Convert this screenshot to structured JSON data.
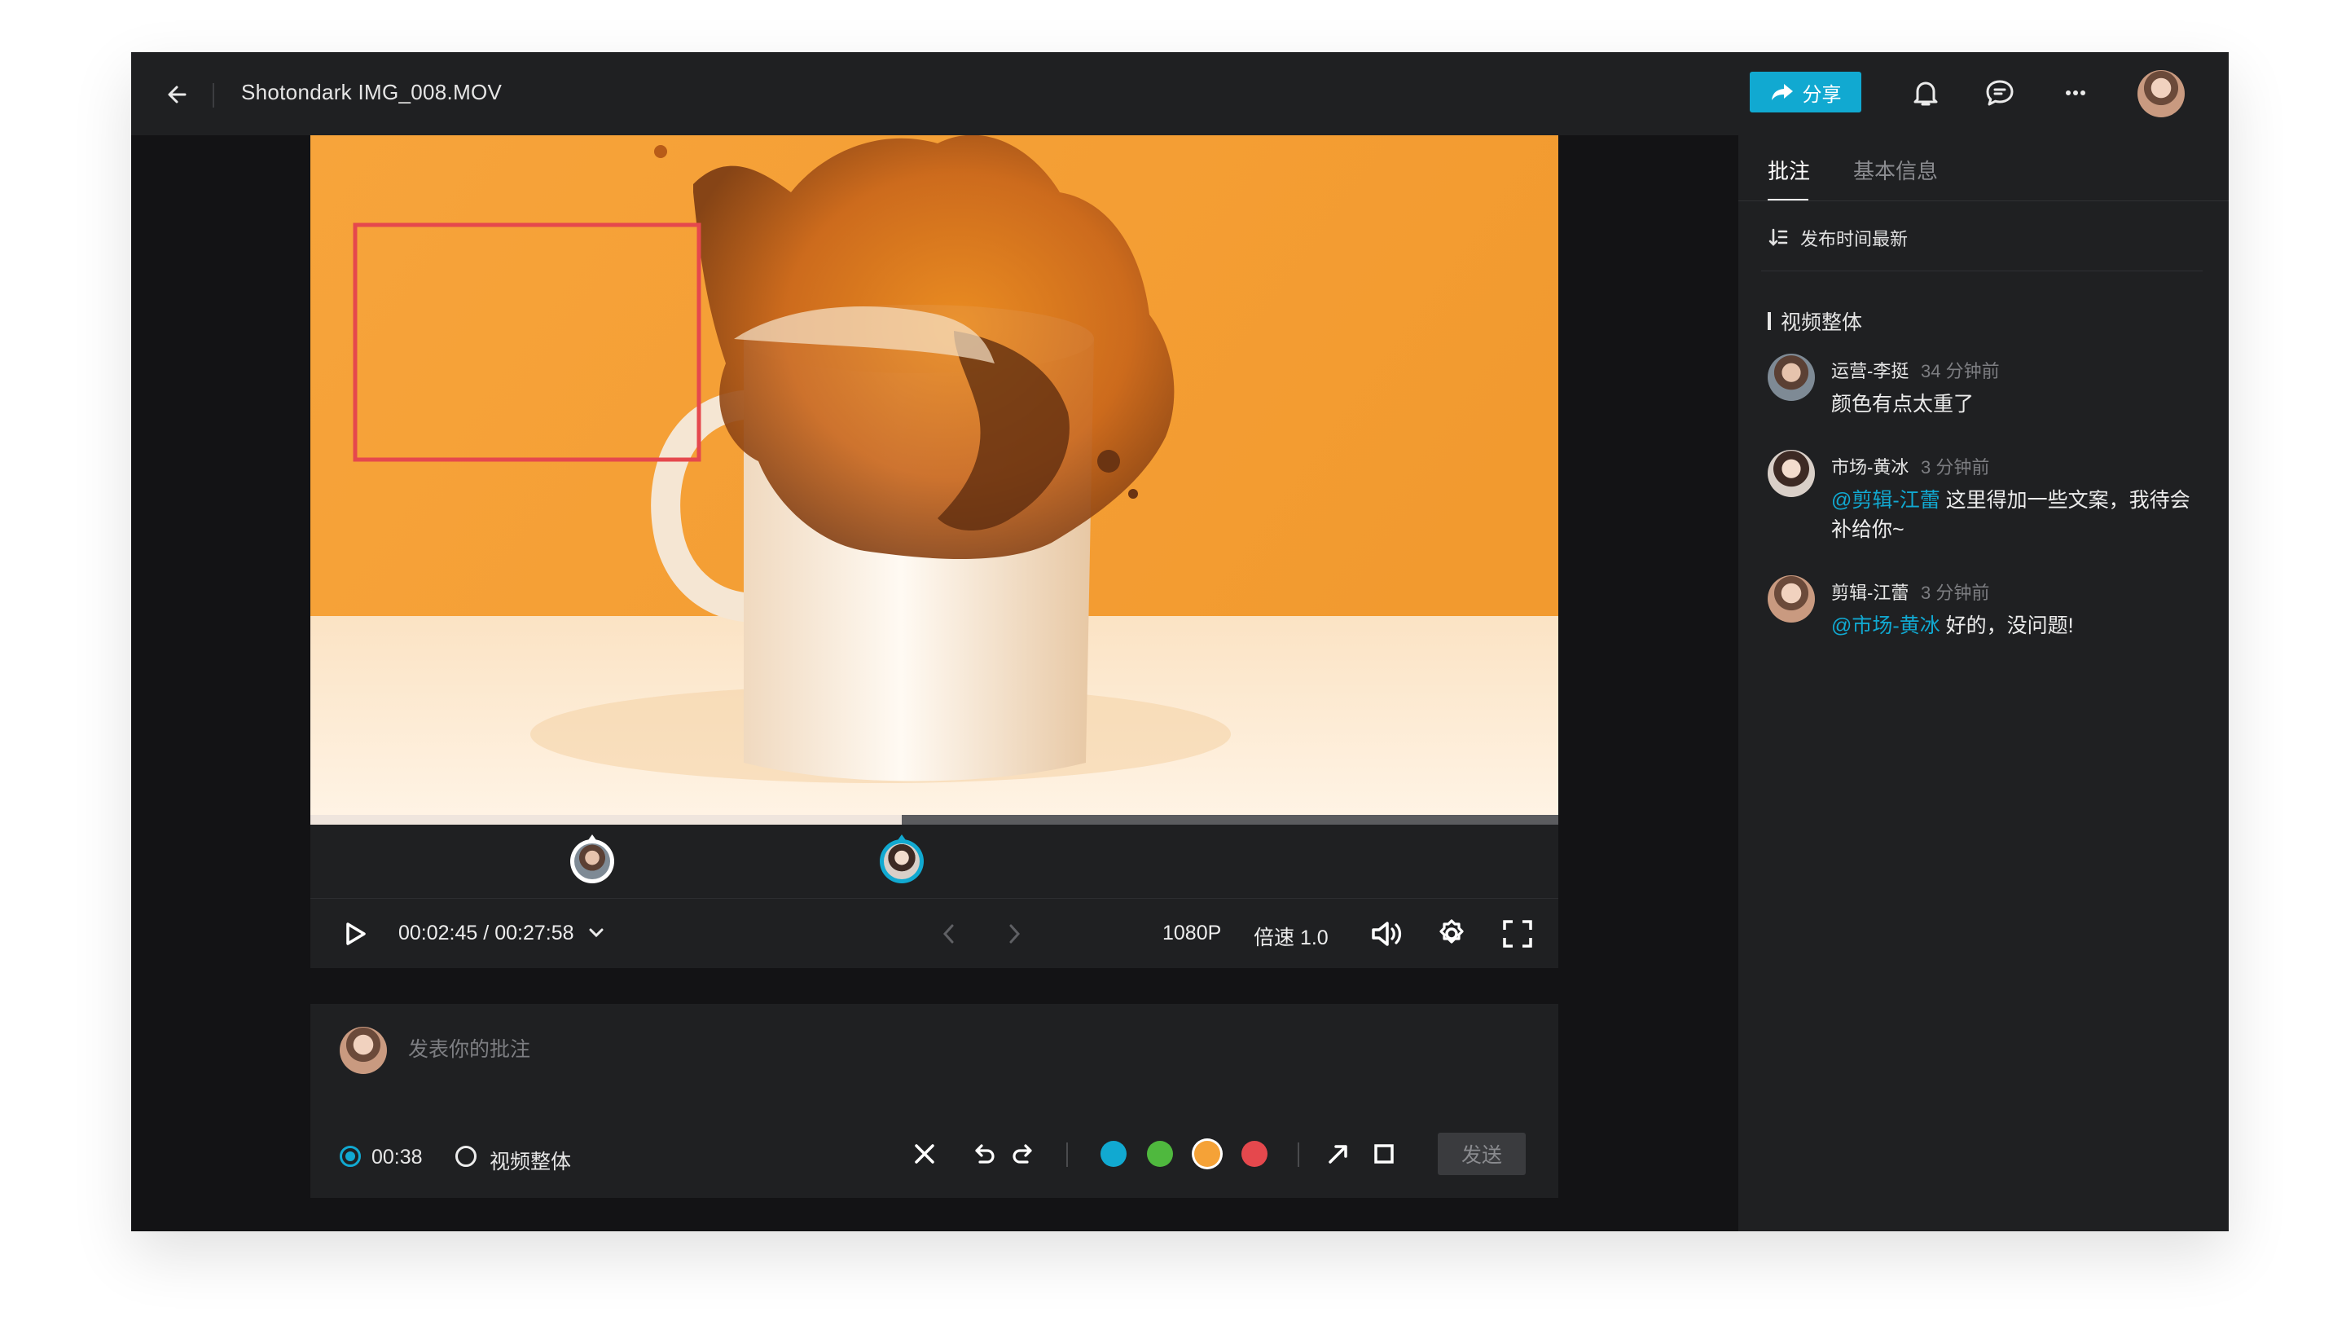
{
  "window": {
    "title": "Shotondark IMG_008.MOV"
  },
  "topbar": {
    "share_label": "分享",
    "icons": [
      "back-arrow-icon",
      "share-icon",
      "bell-icon",
      "chat-bubble-icon",
      "more-icon"
    ]
  },
  "player": {
    "annotation_color": "#e5484d",
    "progress_fraction": 0.474,
    "current_time": "00:02:45",
    "time_separator": "/",
    "total_time": "00:27:58",
    "quality": "1080P",
    "speed": "倍速 1.0",
    "markers": [
      {
        "name": "comment-marker-1"
      },
      {
        "name": "comment-marker-2"
      }
    ]
  },
  "composer": {
    "placeholder": "发表你的批注",
    "radio_time_label": "00:38",
    "radio_whole_label": "视频整体",
    "send_label": "发送",
    "colors": [
      "#11a9d1",
      "#4fb83e",
      "#f5a237",
      "#e5484d"
    ],
    "selected_color": "#f5a237"
  },
  "panel": {
    "tabs": [
      {
        "label": "批注",
        "active": true
      },
      {
        "label": "基本信息",
        "active": false
      }
    ],
    "sort_label": "发布时间最新",
    "section_title": "视频整体",
    "comments": [
      {
        "author": "运营-李挺",
        "time": "34 分钟前",
        "mention": "",
        "text": "颜色有点太重了"
      },
      {
        "author": "市场-黄冰",
        "time": "3 分钟前",
        "mention": "@剪辑-江蕾",
        "text": " 这里得加一些文案，我待会补给你~"
      },
      {
        "author": "剪辑-江蕾",
        "time": "3 分钟前",
        "mention": "@市场-黄冰",
        "text": " 好的，没问题!"
      }
    ]
  }
}
